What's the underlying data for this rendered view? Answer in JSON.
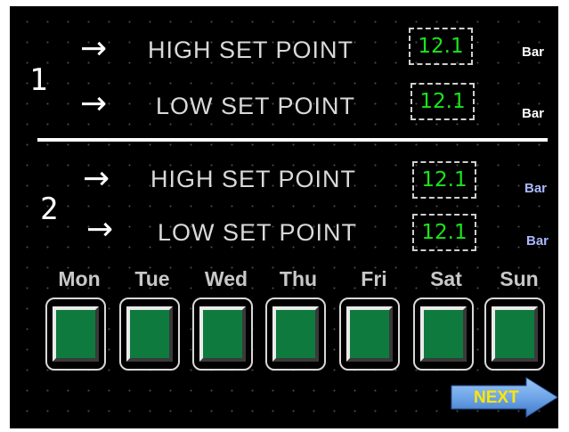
{
  "groups": [
    {
      "number": "1",
      "high": {
        "label": "HIGH SET POINT",
        "value": "12.1",
        "unit": "Bar"
      },
      "low": {
        "label": "LOW SET POINT",
        "value": "12.1",
        "unit": "Bar"
      }
    },
    {
      "number": "2",
      "high": {
        "label": "HIGH SET POINT",
        "value": "12.1",
        "unit": "Bar"
      },
      "low": {
        "label": "LOW SET POINT",
        "value": "12.1",
        "unit": "Bar"
      }
    }
  ],
  "days": [
    "Mon",
    "Tue",
    "Wed",
    "Thu",
    "Fri",
    "Sat",
    "Sun"
  ],
  "next_label": "NEXT",
  "icons": {
    "arrow": "right-arrow-icon",
    "next": "next-arrow-icon"
  },
  "colors": {
    "background": "#000000",
    "value_text": "#19e619",
    "day_button_fill": "#0e7a3e",
    "next_button": "#6fa6e8",
    "next_text": "#ffe600",
    "unit_group2": "#a9b8ff"
  }
}
